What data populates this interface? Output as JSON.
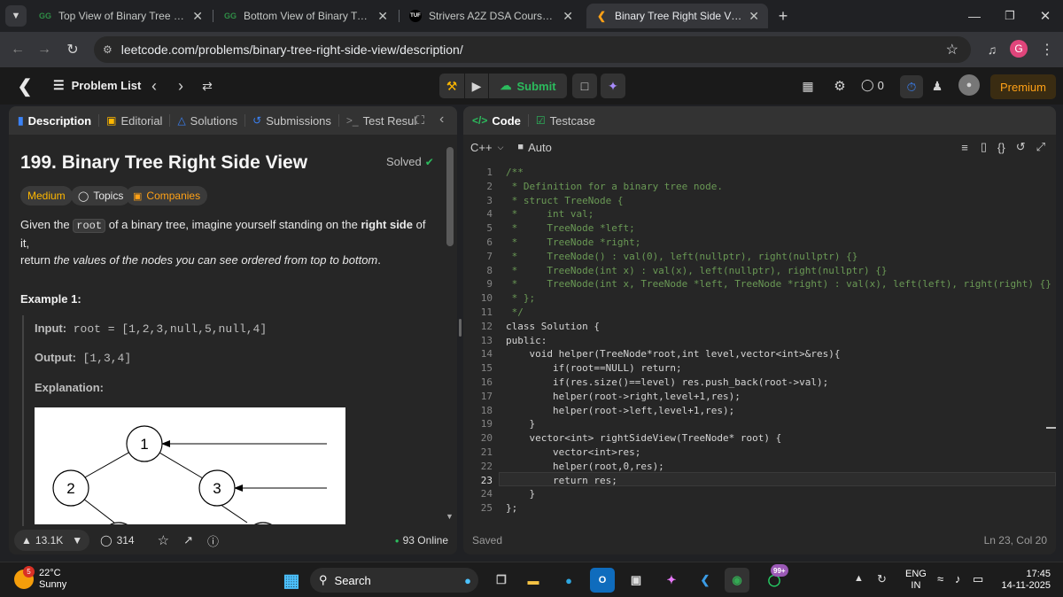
{
  "browser": {
    "tabs": [
      {
        "title": "Top View of Binary Tree | Practic",
        "favicon": "GG",
        "active": false
      },
      {
        "title": "Bottom View of Binary Tree | Pr",
        "favicon": "GG",
        "active": false
      },
      {
        "title": "Strivers A2Z DSA Course/Sheet",
        "favicon": "TUF",
        "active": false
      },
      {
        "title": "Binary Tree Right Side View - Le",
        "favicon": "LC",
        "active": true
      }
    ],
    "url": "leetcode.com/problems/binary-tree-right-side-view/description/",
    "profile_initial": "G"
  },
  "topbar": {
    "problem_list": "Problem List",
    "submit": "Submit",
    "streak": "0",
    "premium": "Premium"
  },
  "left_tabs": [
    "Description",
    "Editorial",
    "Solutions",
    "Submissions",
    "Test Resul"
  ],
  "problem": {
    "title": "199. Binary Tree Right Side View",
    "status": "Solved",
    "difficulty": "Medium",
    "topics": "Topics",
    "companies": "Companies",
    "desc_1": "Given the",
    "desc_code": "root",
    "desc_2": "of a binary tree, imagine yourself standing on the",
    "desc_bold": "right side",
    "desc_3": "of it,",
    "desc_4": "return",
    "desc_italic": "the values of the nodes you can see ordered from top to bottom",
    "desc_end": ".",
    "example_title": "Example 1:",
    "input_label": "Input:",
    "input_value": "root = [1,2,3,null,5,null,4]",
    "output_label": "Output:",
    "output_value": "[1,3,4]",
    "explanation_label": "Explanation:",
    "tree_nodes": [
      "1",
      "2",
      "3"
    ]
  },
  "footer_left": {
    "likes": "13.1K",
    "comments": "314",
    "online": "93 Online"
  },
  "right_tabs": {
    "code": "Code",
    "testcase": "Testcase"
  },
  "editor": {
    "language": "C++",
    "mode": "Auto",
    "status": "Saved",
    "cursor": "Ln 23, Col 20",
    "current_line": 23,
    "lines": [
      "/**",
      " * Definition for a binary tree node.",
      " * struct TreeNode {",
      " *     int val;",
      " *     TreeNode *left;",
      " *     TreeNode *right;",
      " *     TreeNode() : val(0), left(nullptr), right(nullptr) {}",
      " *     TreeNode(int x) : val(x), left(nullptr), right(nullptr) {}",
      " *     TreeNode(int x, TreeNode *left, TreeNode *right) : val(x), left(left), right(right) {}",
      " * };",
      " */",
      "class Solution {",
      "public:",
      "    void helper(TreeNode*root,int level,vector<int>&res){",
      "        if(root==NULL) return;",
      "        if(res.size()==level) res.push_back(root->val);",
      "        helper(root->right,level+1,res);",
      "        helper(root->left,level+1,res);",
      "    }",
      "    vector<int> rightSideView(TreeNode* root) {",
      "        vector<int>res;",
      "        helper(root,0,res);",
      "        return res;",
      "    }",
      "};"
    ]
  },
  "taskbar": {
    "weather_temp": "22°C",
    "weather_desc": "Sunny",
    "weather_badge": "5",
    "search": "Search",
    "notif_badge": "99+",
    "lang_1": "ENG",
    "lang_2": "IN",
    "time": "17:45",
    "date": "14-11-2025"
  },
  "colors": {
    "accent_green": "#2cbb5d",
    "premium": "#ffa116",
    "medium": "#ffb800",
    "comment": "#6a9955",
    "keyword": "#569cd6"
  }
}
